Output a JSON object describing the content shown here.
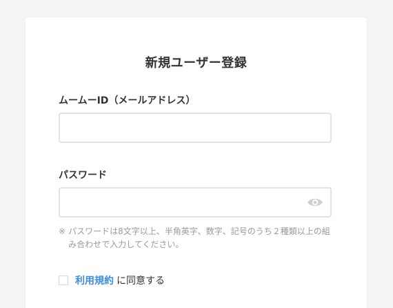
{
  "form": {
    "title": "新規ユーザー登録",
    "id_label": "ムームーID（メールアドレス）",
    "id_value": "",
    "password_label": "パスワード",
    "password_value": "",
    "password_icon": "eye-icon",
    "password_note_mark": "※",
    "password_note": "パスワードは8文字以上、半角英字、数字、記号のうち２種類以上の組み合わせで入力してください。",
    "terms_link": "利用規約",
    "terms_suffix": "に同意する",
    "terms_checked": false
  },
  "colors": {
    "background": "#f4f4f4",
    "card": "#ffffff",
    "link": "#3b8ee0",
    "note": "#999999",
    "border": "#e3e3e3",
    "icon": "#d0d0d0"
  }
}
